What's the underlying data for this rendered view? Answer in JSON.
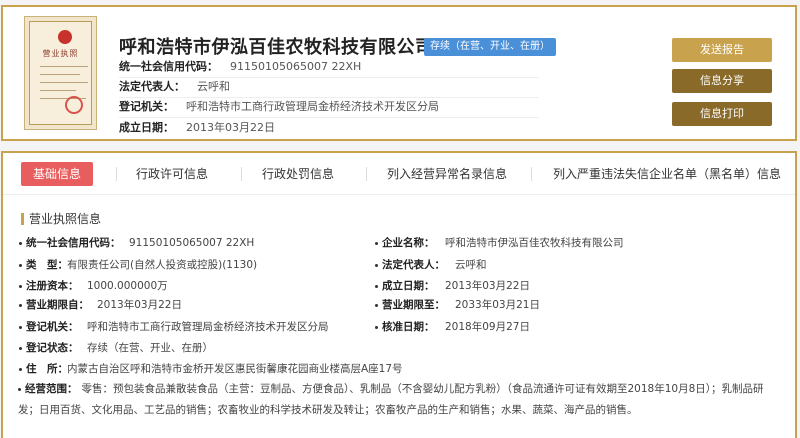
{
  "company": {
    "name": "呼和浩特市伊泓百佳农牧科技有限公司",
    "status": "存续（在营、开业、在册）",
    "license_image_label": "营业执照",
    "credit_code_label": "统一社会信用代码：",
    "credit_code": "91150105065007 22XH",
    "legal_rep_label": "法定代表人：",
    "legal_rep": "云呼和",
    "authority_label": "登记机关：",
    "authority": "呼和浩特市工商行政管理局金桥经济技术开发区分局",
    "founded_label": "成立日期：",
    "founded": "2013年03月22日"
  },
  "actions": {
    "report": "发送报告",
    "share": "信息分享",
    "print": "信息打印"
  },
  "tabs": [
    {
      "label": "基础信息",
      "active": true
    },
    {
      "label": "行政许可信息",
      "active": false
    },
    {
      "label": "行政处罚信息",
      "active": false
    },
    {
      "label": "列入经营异常名录信息",
      "active": false
    },
    {
      "label": "列入严重违法失信企业名单（黑名单）信息",
      "active": false
    }
  ],
  "section": {
    "title": "营业执照信息"
  },
  "fields_left": [
    {
      "label": "统一社会信用代码：",
      "value": "91150105065007 22XH"
    },
    {
      "label": "类　型：",
      "value": "有限责任公司(自然人投资或控股)(1130)"
    },
    {
      "label": "注册资本：",
      "value": "1000.000000万"
    },
    {
      "label": "营业期限自：",
      "value": "2013年03月22日"
    },
    {
      "label": "登记机关：",
      "value": "呼和浩特市工商行政管理局金桥经济技术开发区分局"
    },
    {
      "label": "登记状态：",
      "value": "存续（在营、开业、在册）"
    },
    {
      "label": "住　所：",
      "value": "内蒙古自治区呼和浩特市金桥开发区惠民街馨康花园商业楼高层A座17号"
    }
  ],
  "fields_right": [
    {
      "label": "企业名称：",
      "value": "呼和浩特市伊泓百佳农牧科技有限公司"
    },
    {
      "label": "法定代表人：",
      "value": "云呼和"
    },
    {
      "label": "成立日期：",
      "value": "2013年03月22日"
    },
    {
      "label": "营业期限至：",
      "value": "2033年03月21日"
    },
    {
      "label": "核准日期：",
      "value": "2018年09月27日"
    }
  ],
  "scope": {
    "label": "经营范围：",
    "value": "零售：预包装食品兼散装食品（主营：豆制品、方便食品）、乳制品（不含婴幼儿配方乳粉）（食品流通许可证有效期至2018年10月8日）；乳制品研发；日用百货、文化用品、工艺品的销售；农畜牧业的科学技术研发及转让；农畜牧产品的生产和销售；水果、蔬菜、海产品的销售。"
  },
  "colors": {
    "gold_border": "#c9a24e",
    "status_blue": "#4a90d9",
    "active_tab_red": "#e85e5e",
    "button_brown": "#8a6a28"
  }
}
